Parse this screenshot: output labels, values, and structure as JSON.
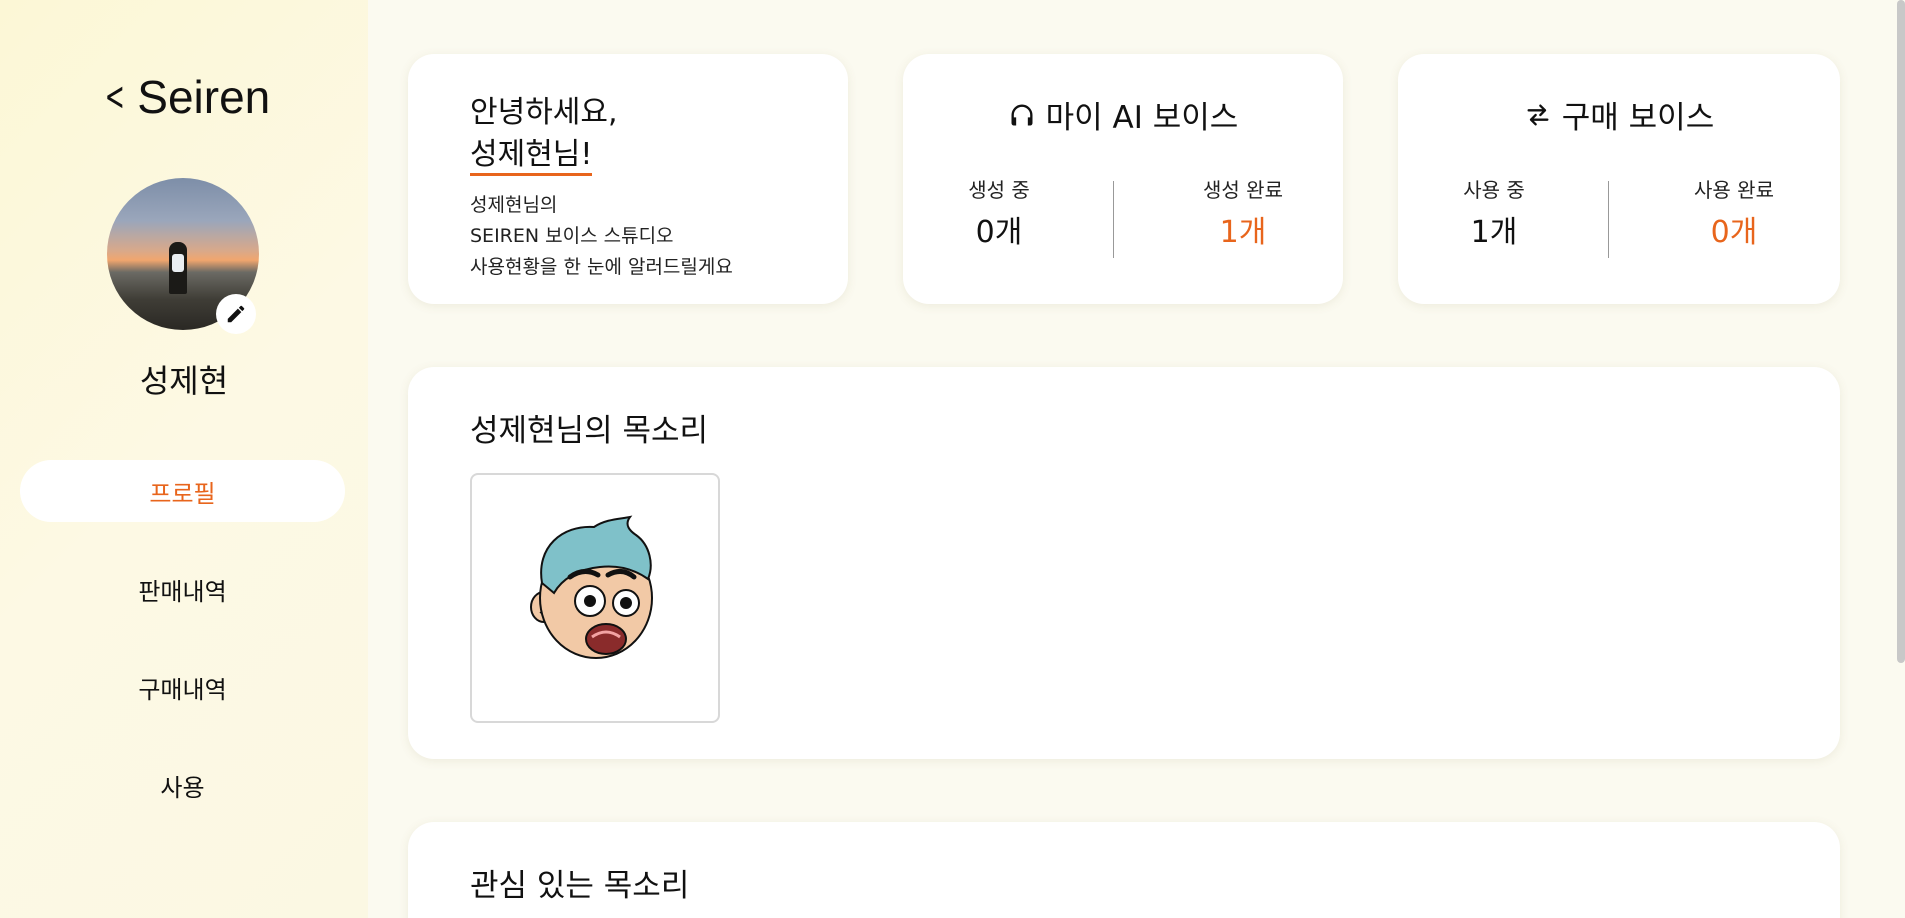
{
  "sidebar": {
    "brand": "Seiren",
    "back_icon": "chevron-left-icon",
    "user_name": "성제현",
    "nav": [
      {
        "label": "프로필",
        "active": true
      },
      {
        "label": "판매내역",
        "active": false
      },
      {
        "label": "구매내역",
        "active": false
      },
      {
        "label": "사용",
        "active": false
      }
    ]
  },
  "greeting": {
    "line1": "안녕하세요,",
    "line2": "성제현님!",
    "sub1": "성제현님의",
    "sub2": "SEIREN 보이스 스튜디오",
    "sub3": "사용현황을 한 눈에 알러드릴게요"
  },
  "my_ai_voice": {
    "icon": "headphones-icon",
    "title": "마이 AI 보이스",
    "left_label": "생성 중",
    "left_value": "0개",
    "right_label": "생성 완료",
    "right_value": "1개"
  },
  "purchased_voice": {
    "icon": "swap-arrows-icon",
    "title": "구매 보이스",
    "left_label": "사용 중",
    "left_value": "1개",
    "right_label": "사용 완료",
    "right_value": "0개"
  },
  "my_voice_section": {
    "title": "성제현님의 목소리",
    "tiles": [
      {
        "icon": "cartoon-face-icon"
      }
    ]
  },
  "interest_section": {
    "title": "관심 있는 목소리"
  },
  "colors": {
    "accent": "#e8651c",
    "sidebar_bg": "#fcf7d6",
    "page_bg": "#fbfaf0",
    "card_bg": "#ffffff"
  }
}
